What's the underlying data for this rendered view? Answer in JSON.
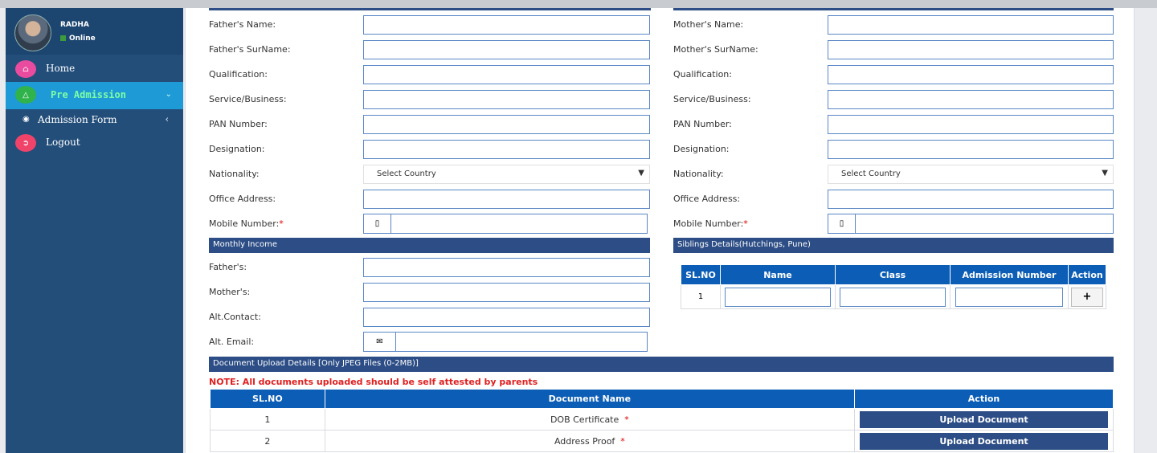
{
  "user": {
    "name": "RADHA",
    "status": "Online"
  },
  "sidebar": {
    "items": [
      {
        "label": "Home",
        "icon": "home-icon",
        "color": "#e94b9f"
      },
      {
        "label": "Pre Admission",
        "icon": "graduation-cap-icon",
        "color": "#2fb34a"
      },
      {
        "label": "Admission Form",
        "icon": "globe-icon"
      },
      {
        "label": "Logout",
        "icon": "logout-icon",
        "color": "#f0436a"
      }
    ]
  },
  "father": {
    "name": "Father's Name:",
    "surname": "Father's SurName:",
    "qualification": "Qualification:",
    "service": "Service/Business:",
    "pan": "PAN Number:",
    "designation": "Designation:",
    "nationality": "Nationality:",
    "nationality_value": "Select Country",
    "office": "Office Address:",
    "mobile": "Mobile Number:"
  },
  "mother": {
    "name": "Mother's Name:",
    "surname": "Mother's SurName:",
    "qualification": "Qualification:",
    "service": "Service/Business:",
    "pan": "PAN Number:",
    "designation": "Designation:",
    "nationality": "Nationality:",
    "nationality_value": "Select Country",
    "office": "Office Address:",
    "mobile": "Mobile Number:"
  },
  "required_mark": "*",
  "income": {
    "title": "Monthly Income",
    "fathers": "Father's:",
    "mothers": "Mother's:",
    "alt_contact": "Alt.Contact:",
    "alt_email": "Alt. Email:"
  },
  "siblings": {
    "title": "Siblings Details(Hutchings, Pune)",
    "headers": [
      "SL.NO",
      "Name",
      "Class",
      "Admission Number",
      "Action"
    ],
    "rows": [
      {
        "sl": "1"
      }
    ],
    "add_label": "+"
  },
  "documents": {
    "title": "Document Upload Details [Only JPEG Files (0-2MB)]",
    "note": "NOTE: All documents uploaded should be self attested by parents",
    "headers": [
      "SL.NO",
      "Document Name",
      "Action"
    ],
    "rows": [
      {
        "sl": "1",
        "name": "DOB Certificate",
        "action": "Upload Document"
      },
      {
        "sl": "2",
        "name": "Address Proof",
        "action": "Upload Document"
      }
    ]
  }
}
